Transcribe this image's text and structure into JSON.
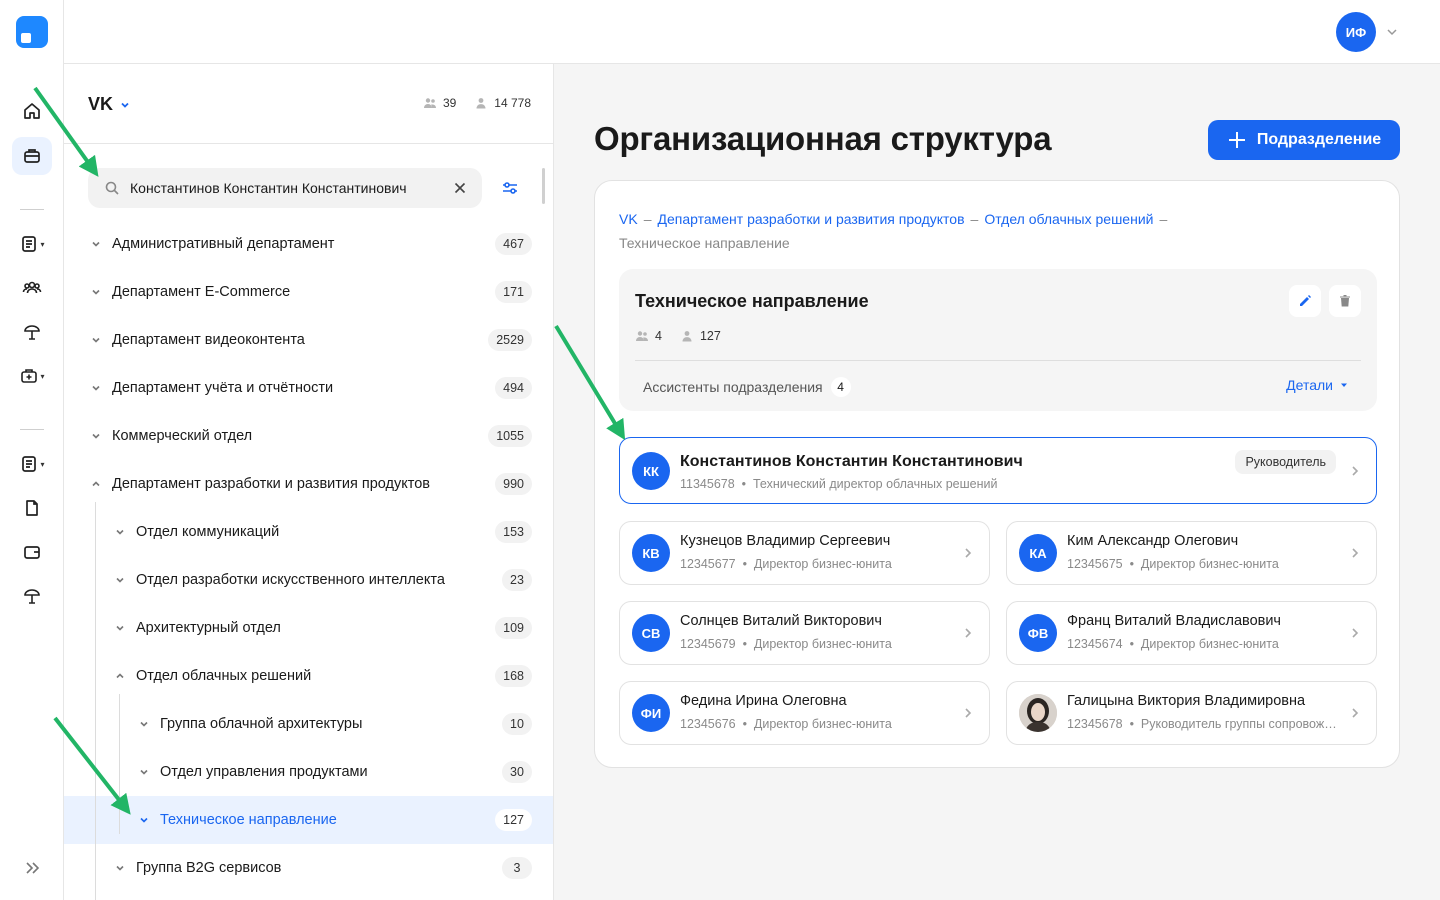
{
  "user": {
    "initials": "ИФ"
  },
  "org": {
    "name": "VK",
    "units_count": "39",
    "people_count": "14 778"
  },
  "search": {
    "value": "Константинов Константин Константинович"
  },
  "tree": [
    {
      "label": "Административный департамент",
      "count": "467",
      "level": 0,
      "open": false
    },
    {
      "label": "Департамент E-Commerce",
      "count": "171",
      "level": 0,
      "open": false
    },
    {
      "label": "Департамент видеоконтента",
      "count": "2529",
      "level": 0,
      "open": false
    },
    {
      "label": "Департамент учёта и отчётности",
      "count": "494",
      "level": 0,
      "open": false
    },
    {
      "label": "Коммерческий отдел",
      "count": "1055",
      "level": 0,
      "open": false
    },
    {
      "label": "Департамент разработки и развития продуктов",
      "count": "990",
      "level": 0,
      "open": true
    },
    {
      "label": "Отдел коммуникаций",
      "count": "153",
      "level": 1,
      "open": false
    },
    {
      "label": "Отдел разработки искусственного интеллекта",
      "count": "23",
      "level": 1,
      "open": false
    },
    {
      "label": "Архитектурный отдел",
      "count": "109",
      "level": 1,
      "open": false
    },
    {
      "label": "Отдел облачных решений",
      "count": "168",
      "level": 1,
      "open": true
    },
    {
      "label": "Группа облачной архитектуры",
      "count": "10",
      "level": 2,
      "open": false
    },
    {
      "label": "Отдел управления продуктами",
      "count": "30",
      "level": 2,
      "open": false
    },
    {
      "label": "Техническое направление",
      "count": "127",
      "level": 2,
      "open": false,
      "selected": true
    },
    {
      "label": "Группа B2G сервисов",
      "count": "3",
      "level": 1,
      "open": false
    }
  ],
  "main": {
    "title": "Организационная структура",
    "add_button": "Подразделение",
    "breadcrumbs": [
      "VK",
      "Департамент разработки и развития продуктов",
      "Отдел облачных решений"
    ],
    "breadcrumb_current": "Техническое направление",
    "unit": {
      "title": "Техническое направление",
      "units": "4",
      "people": "127",
      "assistants_label": "Ассистенты подразделения",
      "assistants_count": "4",
      "details": "Детали"
    },
    "lead": {
      "initials": "КК",
      "name": "Константинов Константин Константинович",
      "id": "11345678",
      "position": "Технический директор облачных решений",
      "role": "Руководитель"
    },
    "people": [
      {
        "initials": "КВ",
        "name": "Кузнецов Владимир Сергеевич",
        "id": "12345677",
        "position": "Директор бизнес-юнита"
      },
      {
        "initials": "КА",
        "name": "Ким Александр Олегович",
        "id": "12345675",
        "position": "Директор бизнес-юнита"
      },
      {
        "initials": "СВ",
        "name": "Солнцев Виталий Викторович",
        "id": "12345679",
        "position": "Директор бизнес-юнита"
      },
      {
        "initials": "ФВ",
        "name": "Франц Виталий Владиславович",
        "id": "12345674",
        "position": "Директор бизнес-юнита"
      },
      {
        "initials": "ФИ",
        "name": "Федина Ирина Олеговна",
        "id": "12345676",
        "position": "Директор бизнес-юнита"
      },
      {
        "initials": "",
        "photo": true,
        "name": "Галицына Виктория Владимировна",
        "id": "12345678",
        "position": "Руководитель группы сопровождения"
      }
    ]
  },
  "colors": {
    "accent": "#1a66f0",
    "selected_bg": "#eaf2ff",
    "arrow": "#22b566"
  }
}
